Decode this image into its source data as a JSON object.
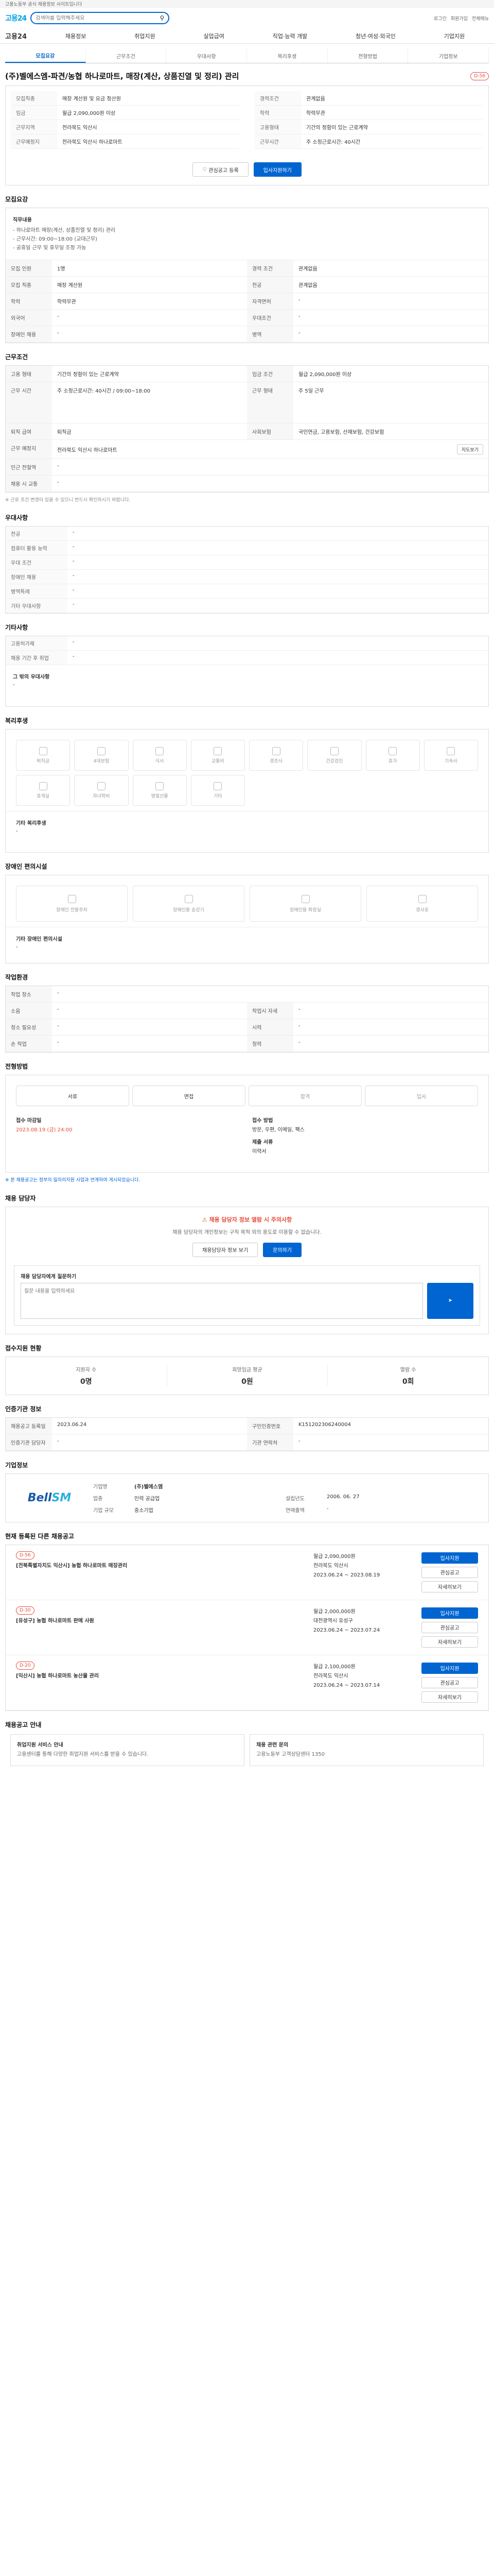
{
  "topbar": {
    "text": "고용노동부 공식 채용정보 사이트입니다"
  },
  "header": {
    "logo": "고용24",
    "search_placeholder": "검색어를 입력해주세요",
    "top_links": [
      "로그인",
      "회원가입",
      "전체메뉴"
    ]
  },
  "gnb": {
    "home": "고용24",
    "items": [
      "채용정보",
      "취업지원",
      "실업급여",
      "직업·능력 개발",
      "청년·여성·외국인",
      "기업지원"
    ]
  },
  "tabs": [
    "모집요강",
    "근무조건",
    "우대사항",
    "복리후생",
    "전형방법",
    "기업정보"
  ],
  "posting": {
    "title": "(주)벨에스엠-파견/농협 하나로마트, 매장(계산, 상품진열 및 정리) 관리",
    "badge": "D-56",
    "basic": [
      {
        "k": "모집직종",
        "v": "매장 계산원 및 요금 정산원"
      },
      {
        "k": "경력조건",
        "v": "관계없음"
      },
      {
        "k": "임금",
        "v": "월급 2,090,000원 이상"
      },
      {
        "k": "학력",
        "v": "학력무관"
      },
      {
        "k": "근무지역",
        "v": "전라북도 익산시"
      },
      {
        "k": "고용형태",
        "v": "기간의 정함이 있는 근로계약"
      },
      {
        "k": "근무예정지",
        "v": "전라북도 익산시 하나로마트"
      },
      {
        "k": "근무시간",
        "v": "주 소정근로시간: 40시간"
      }
    ],
    "buttons": {
      "scrap": "관심공고 등록",
      "apply": "입사지원하기"
    }
  },
  "recruit": {
    "title": "모집요강",
    "duty_title": "직무내용",
    "duty": "- 하나로마트 매장(계산, 상품진열 및 정리) 관리\n- 근무시간: 09:00~18:00 (교대근무)\n- 공휴일 근무 및 휴무일 조정 가능",
    "rows": [
      {
        "k": "모집 인원",
        "v": "1명",
        "k2": "경력 조건",
        "v2": "관계없음"
      },
      {
        "k": "모집 직종",
        "v": "매장 계산원",
        "k2": "전공",
        "v2": "관계없음"
      },
      {
        "k": "학력",
        "v": "학력무관",
        "k2": "자격면허",
        "v2": "-"
      },
      {
        "k": "외국어",
        "v": "-",
        "k2": "우대조건",
        "v2": "-"
      },
      {
        "k": "장애인 채용",
        "v": "-",
        "k2": "병역",
        "v2": "-"
      }
    ]
  },
  "work": {
    "title": "근무조건",
    "rows": [
      {
        "k": "고용 형태",
        "v": "기간의 정함이 있는 근로계약",
        "k2": "임금 조건",
        "v2": "월급 2,090,000원 이상"
      },
      {
        "k": "근무 시간",
        "v": "주 소정근로시간: 40시간 / 09:00~18:00",
        "k2": "근무 형태",
        "v2": "주 5일 근무"
      },
      {
        "k": "퇴직 급여",
        "v": "퇴직금",
        "k2": "사회보험",
        "v2": "국민연금, 고용보험, 산재보험, 건강보험"
      },
      {
        "k": "근무 예정지",
        "v": "전라북도 익산시 하나로마트",
        "k2": "",
        "v2": ""
      },
      {
        "k": "인근 전철역",
        "v": "-",
        "k2": "",
        "v2": ""
      },
      {
        "k": "채용 시 교통",
        "v": "-",
        "k2": "",
        "v2": ""
      }
    ],
    "map_button": "지도보기",
    "note": "※ 근로 조건 변경이 있을 수 있으니 반드시 확인하시기 바랍니다."
  },
  "prefer": {
    "title": "우대사항",
    "rows": [
      {
        "k": "전공",
        "v": "-"
      },
      {
        "k": "컴퓨터 활용 능력",
        "v": "-"
      },
      {
        "k": "우대 조건",
        "v": "-"
      },
      {
        "k": "장애인 채용",
        "v": "-"
      },
      {
        "k": "병역특례",
        "v": "-"
      },
      {
        "k": "기타 우대사항",
        "v": "-"
      }
    ]
  },
  "etc": {
    "title": "기타사항",
    "rows": [
      {
        "k": "고용허가제",
        "v": "-"
      },
      {
        "k": "채용 기간 후 취업",
        "v": "-"
      }
    ],
    "other_title": "그 밖의 우대사항",
    "other_value": "-"
  },
  "welfare": {
    "title": "복리후생",
    "items": [
      "퇴직금",
      "4대보험",
      "식사",
      "교통비",
      "경조사",
      "건강검진",
      "휴가",
      "기숙사",
      "휴게실",
      "자녀학비",
      "명절선물",
      "기타"
    ],
    "other_title": "기타 복리후생",
    "other_value": "-"
  },
  "disabled": {
    "title": "장애인 편의시설",
    "items": [
      "장애인 전용주차",
      "장애인용 승강기",
      "장애인용 화장실",
      "경사로"
    ],
    "other_title": "기타 장애인 편의시설",
    "other_value": "-"
  },
  "workplace": {
    "title": "작업환경",
    "rows": [
      {
        "k": "작업 장소",
        "v": "-",
        "k2": "",
        "v2": ""
      },
      {
        "k": "소음",
        "v": "-",
        "k2": "작업시 자세",
        "v2": "-"
      },
      {
        "k": "청소 필요성",
        "v": "-",
        "k2": "시력",
        "v2": "-"
      },
      {
        "k": "손 작업",
        "v": "-",
        "k2": "청력",
        "v2": "-"
      }
    ]
  },
  "selection": {
    "title": "전형방법",
    "steps": [
      "서류",
      "면접",
      "합격",
      "입사"
    ],
    "deadline_k": "접수 마감일",
    "deadline": "2023.08.19 (금) 24:00",
    "method_k": "접수 방법",
    "method": "방문, 우편, 이메일, 팩스",
    "docs_k": "제출 서류",
    "docs": "이력서",
    "notice": "※ 본 채용공고는 정부의 일자리지원 사업과 연계하여 게시되었습니다."
  },
  "contact": {
    "title": "채용 담당자",
    "alert": "채용 담당자 정보 열람 시 주의사항",
    "body": "채용 담당자의 개인정보는 구직 목적 외의 용도로 이용할 수 없습니다.",
    "btn1": "채용담당자 정보 보기",
    "btn2": "문의하기",
    "qa_title": "채용 담당자에게 질문하기",
    "qa_placeholder": "질문 내용을 입력하세요"
  },
  "status": {
    "title": "접수지원 현황",
    "items": [
      {
        "label": "지원자 수",
        "value": "0명"
      },
      {
        "label": "희망임금 평균",
        "value": "0원"
      },
      {
        "label": "열람 수",
        "value": "0회"
      }
    ]
  },
  "info": {
    "title": "인증기관 정보",
    "rows": [
      {
        "k": "채용공고 등록일",
        "v": "2023.06.24",
        "k2": "구인인증번호",
        "v2": "K151202306240004"
      },
      {
        "k": "인증기관 담당자",
        "v": "-",
        "k2": "기관 연락처",
        "v2": "-"
      }
    ]
  },
  "company": {
    "title": "기업정보",
    "logo_text1": "Bell",
    "logo_text2": "SM",
    "name_k": "기업명",
    "name": "(주)벨에스엠",
    "rows": [
      {
        "k": "업종",
        "v": "인력 공급업"
      },
      {
        "k": "기업 규모",
        "v": "중소기업"
      },
      {
        "k": "설립년도",
        "v": "2006. 06. 27"
      },
      {
        "k": "연매출액",
        "v": "-"
      }
    ]
  },
  "related": {
    "title": "현재 등록된 다른 채용공고",
    "items": [
      {
        "badge": "D-56",
        "title": "[전북특별자치도 익산시] 농협 하나로마트 매장관리",
        "salary": "월급 2,090,000원",
        "loc": "전라북도 익산시",
        "date": "2023.06.24 ~ 2023.08.19"
      },
      {
        "badge": "D-30",
        "title": "[유성구] 농협 하나로마트 판매 사원",
        "salary": "월급 2,000,000원",
        "loc": "대전광역시 유성구",
        "date": "2023.06.24 ~ 2023.07.24"
      },
      {
        "badge": "D-20",
        "title": "[익산시] 농협 하나로마트 농산물 관리",
        "salary": "월급 2,100,000원",
        "loc": "전라북도 익산시",
        "date": "2023.06.24 ~ 2023.07.14"
      }
    ],
    "btn_apply": "입사지원",
    "btn_scrap": "관심공고",
    "btn_detail": "자세히보기"
  },
  "footer": {
    "title": "채용공고 안내",
    "cards": [
      {
        "title": "취업지원 서비스 안내",
        "body": "고용센터를 통해 다양한 취업지원 서비스를 받을 수 있습니다."
      },
      {
        "title": "채용 관련 문의",
        "body": "고용노동부 고객상담센터 1350"
      }
    ]
  }
}
